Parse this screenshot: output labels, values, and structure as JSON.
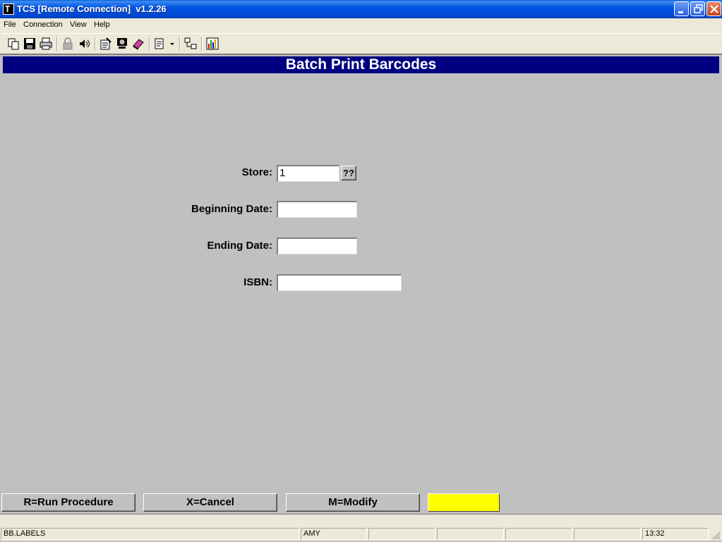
{
  "window": {
    "title": "TCS [Remote Connection]  v1.2.26",
    "icon": "terminal-icon",
    "icon_glyph": "T"
  },
  "menubar": {
    "items": [
      {
        "label": "File"
      },
      {
        "label": "Connection"
      },
      {
        "label": "View"
      },
      {
        "label": "Help"
      }
    ]
  },
  "toolbar": {
    "icons": [
      "copy-icon",
      "save-icon",
      "print-icon",
      "lock-icon",
      "sound-icon",
      "properties-icon",
      "monitor-icon",
      "book-icon",
      "page-dropdown-icon",
      "network-icon",
      "chart-icon"
    ]
  },
  "screen": {
    "heading": "Batch Print Barcodes",
    "fields": {
      "store": {
        "label": "Store:",
        "value": "1"
      },
      "beginning_date": {
        "label": "Beginning Date:",
        "value": ""
      },
      "ending_date": {
        "label": "Ending Date:",
        "value": ""
      },
      "isbn": {
        "label": "ISBN:",
        "value": ""
      }
    },
    "lookup_label": "??",
    "buttons": {
      "run": "R=Run Procedure",
      "cancel": "X=Cancel",
      "modify": "M=Modify"
    },
    "colors": {
      "header_band": "#000080",
      "indicator": "#ffff00"
    }
  },
  "statusbar": {
    "program": "BB.LABELS",
    "user": "AMY",
    "time": "13:32"
  }
}
